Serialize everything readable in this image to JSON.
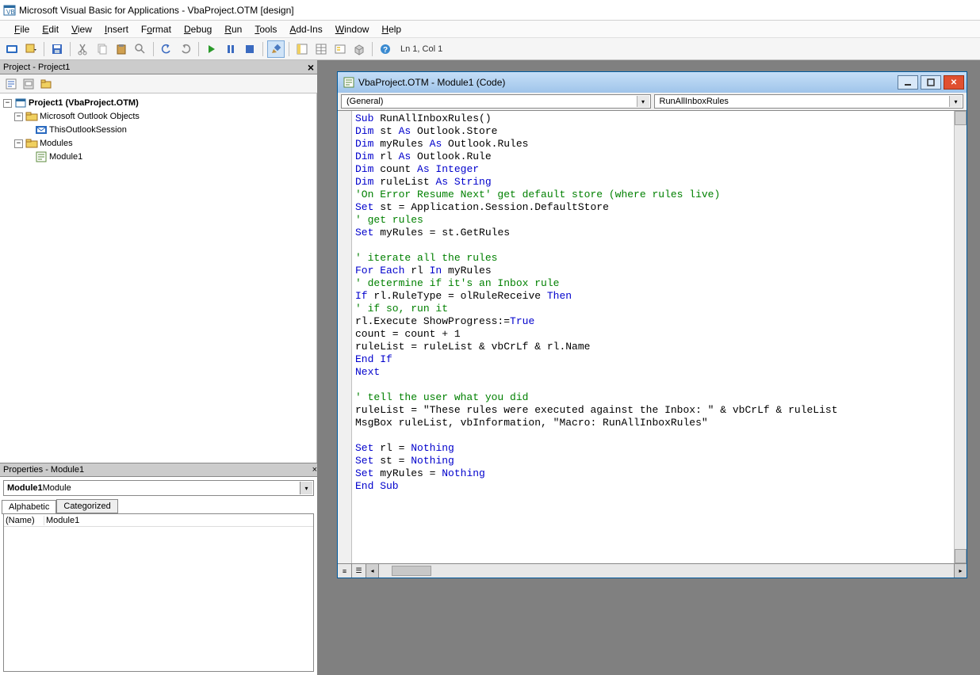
{
  "window": {
    "title": "Microsoft Visual Basic for Applications - VbaProject.OTM [design]"
  },
  "menu": {
    "file": "File",
    "edit": "Edit",
    "view": "View",
    "insert": "Insert",
    "format": "Format",
    "debug": "Debug",
    "run": "Run",
    "tools": "Tools",
    "addins": "Add-Ins",
    "window": "Window",
    "help": "Help"
  },
  "toolbar": {
    "status": "Ln 1, Col 1"
  },
  "project_panel": {
    "title": "Project - Project1",
    "root": "Project1 (VbaProject.OTM)",
    "folder_outlook": "Microsoft Outlook Objects",
    "this_session": "ThisOutlookSession",
    "folder_modules": "Modules",
    "module1": "Module1"
  },
  "properties_panel": {
    "title": "Properties - Module1",
    "combo_bold": "Module1",
    "combo_rest": " Module",
    "tab_alpha": "Alphabetic",
    "tab_cat": "Categorized",
    "row_name_k": "(Name)",
    "row_name_v": "Module1"
  },
  "code_window": {
    "title": "VbaProject.OTM - Module1 (Code)",
    "combo_left": "(General)",
    "combo_right": "RunAllInboxRules"
  },
  "code": [
    {
      "t": "kw",
      "s": "Sub "
    },
    {
      "t": "tx",
      "s": "RunAllInboxRules()"
    },
    {
      "t": "nl"
    },
    {
      "t": "kw",
      "s": "Dim "
    },
    {
      "t": "tx",
      "s": "st "
    },
    {
      "t": "kw",
      "s": "As "
    },
    {
      "t": "tx",
      "s": "Outlook.Store"
    },
    {
      "t": "nl"
    },
    {
      "t": "kw",
      "s": "Dim "
    },
    {
      "t": "tx",
      "s": "myRules "
    },
    {
      "t": "kw",
      "s": "As "
    },
    {
      "t": "tx",
      "s": "Outlook.Rules"
    },
    {
      "t": "nl"
    },
    {
      "t": "kw",
      "s": "Dim "
    },
    {
      "t": "tx",
      "s": "rl "
    },
    {
      "t": "kw",
      "s": "As "
    },
    {
      "t": "tx",
      "s": "Outlook.Rule"
    },
    {
      "t": "nl"
    },
    {
      "t": "kw",
      "s": "Dim "
    },
    {
      "t": "tx",
      "s": "count "
    },
    {
      "t": "kw",
      "s": "As Integer"
    },
    {
      "t": "nl"
    },
    {
      "t": "kw",
      "s": "Dim "
    },
    {
      "t": "tx",
      "s": "ruleList "
    },
    {
      "t": "kw",
      "s": "As String"
    },
    {
      "t": "nl"
    },
    {
      "t": "cm",
      "s": "'On Error Resume Next' get default store (where rules live)"
    },
    {
      "t": "nl"
    },
    {
      "t": "kw",
      "s": "Set "
    },
    {
      "t": "tx",
      "s": "st = Application.Session.DefaultStore"
    },
    {
      "t": "nl"
    },
    {
      "t": "cm",
      "s": "' get rules"
    },
    {
      "t": "nl"
    },
    {
      "t": "kw",
      "s": "Set "
    },
    {
      "t": "tx",
      "s": "myRules = st.GetRules"
    },
    {
      "t": "nl"
    },
    {
      "t": "nl"
    },
    {
      "t": "cm",
      "s": "' iterate all the rules"
    },
    {
      "t": "nl"
    },
    {
      "t": "kw",
      "s": "For Each "
    },
    {
      "t": "tx",
      "s": "rl "
    },
    {
      "t": "kw",
      "s": "In "
    },
    {
      "t": "tx",
      "s": "myRules"
    },
    {
      "t": "nl"
    },
    {
      "t": "cm",
      "s": "' determine if it's an Inbox rule"
    },
    {
      "t": "nl"
    },
    {
      "t": "kw",
      "s": "If "
    },
    {
      "t": "tx",
      "s": "rl.RuleType = olRuleReceive "
    },
    {
      "t": "kw",
      "s": "Then"
    },
    {
      "t": "nl"
    },
    {
      "t": "cm",
      "s": "' if so, run it"
    },
    {
      "t": "nl"
    },
    {
      "t": "tx",
      "s": "rl.Execute ShowProgress:="
    },
    {
      "t": "kw",
      "s": "True"
    },
    {
      "t": "nl"
    },
    {
      "t": "tx",
      "s": "count = count + 1"
    },
    {
      "t": "nl"
    },
    {
      "t": "tx",
      "s": "ruleList = ruleList & vbCrLf & rl.Name"
    },
    {
      "t": "nl"
    },
    {
      "t": "kw",
      "s": "End If"
    },
    {
      "t": "nl"
    },
    {
      "t": "kw",
      "s": "Next"
    },
    {
      "t": "nl"
    },
    {
      "t": "nl"
    },
    {
      "t": "cm",
      "s": "' tell the user what you did"
    },
    {
      "t": "nl"
    },
    {
      "t": "tx",
      "s": "ruleList = \"These rules were executed against the Inbox: \" & vbCrLf & ruleList"
    },
    {
      "t": "nl"
    },
    {
      "t": "tx",
      "s": "MsgBox ruleList, vbInformation, \"Macro: RunAllInboxRules\""
    },
    {
      "t": "nl"
    },
    {
      "t": "nl"
    },
    {
      "t": "kw",
      "s": "Set "
    },
    {
      "t": "tx",
      "s": "rl = "
    },
    {
      "t": "kw",
      "s": "Nothing"
    },
    {
      "t": "nl"
    },
    {
      "t": "kw",
      "s": "Set "
    },
    {
      "t": "tx",
      "s": "st = "
    },
    {
      "t": "kw",
      "s": "Nothing"
    },
    {
      "t": "nl"
    },
    {
      "t": "kw",
      "s": "Set "
    },
    {
      "t": "tx",
      "s": "myRules = "
    },
    {
      "t": "kw",
      "s": "Nothing"
    },
    {
      "t": "nl"
    },
    {
      "t": "kw",
      "s": "End Sub"
    },
    {
      "t": "nl"
    }
  ]
}
